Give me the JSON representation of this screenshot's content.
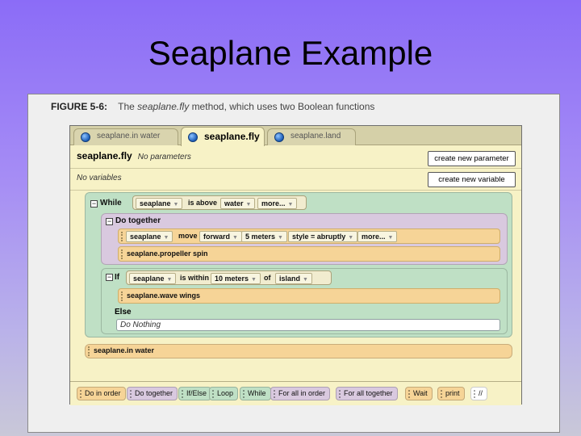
{
  "slide": {
    "title": "Seaplane Example"
  },
  "figure": {
    "caption_number": "FIGURE 5-6:",
    "caption_pre": "The",
    "caption_method": "seaplane.fly",
    "caption_post": "method, which uses two Boolean functions"
  },
  "tabs": [
    {
      "label": "seaplane.in water"
    },
    {
      "label": "seaplane.fly"
    },
    {
      "label": "seaplane.land"
    }
  ],
  "method": {
    "name": "seaplane.fly",
    "params": "No parameters",
    "variables": "No variables",
    "create_param_button": "create new parameter",
    "create_var_button": "create new variable"
  },
  "code": {
    "while_kw": "While",
    "while_cond": {
      "object": "seaplane",
      "func": "is above",
      "target": "water",
      "more": "more..."
    },
    "do_together_kw": "Do together",
    "move_stmt": {
      "object": "seaplane",
      "verb": "move",
      "direction": "forward",
      "amount": "5 meters",
      "style": "style = abruptly",
      "more": "more..."
    },
    "spin_stmt": "seaplane.propeller spin",
    "if_kw": "If",
    "if_cond": {
      "object": "seaplane",
      "func": "is within",
      "distance": "10 meters",
      "of": "of",
      "target": "island"
    },
    "wave_stmt": "seaplane.wave wings",
    "else_kw": "Else",
    "do_nothing": "Do Nothing",
    "in_water_stmt": "seaplane.in water"
  },
  "palette": [
    {
      "label": "Do in order",
      "color": "#f6d497"
    },
    {
      "label": "Do together",
      "color": "#d9c9df"
    },
    {
      "label": "If/Else",
      "color": "#bfe0c5"
    },
    {
      "label": "Loop",
      "color": "#bfe0c5"
    },
    {
      "label": "While",
      "color": "#bfe0c5"
    },
    {
      "label": "For all in order",
      "color": "#d9c9df"
    },
    {
      "label": "For all together",
      "color": "#d9c9df"
    },
    {
      "label": "Wait",
      "color": "#f6d497"
    },
    {
      "label": "print",
      "color": "#f6d497"
    },
    {
      "label": "//",
      "color": "#ffffff"
    }
  ]
}
